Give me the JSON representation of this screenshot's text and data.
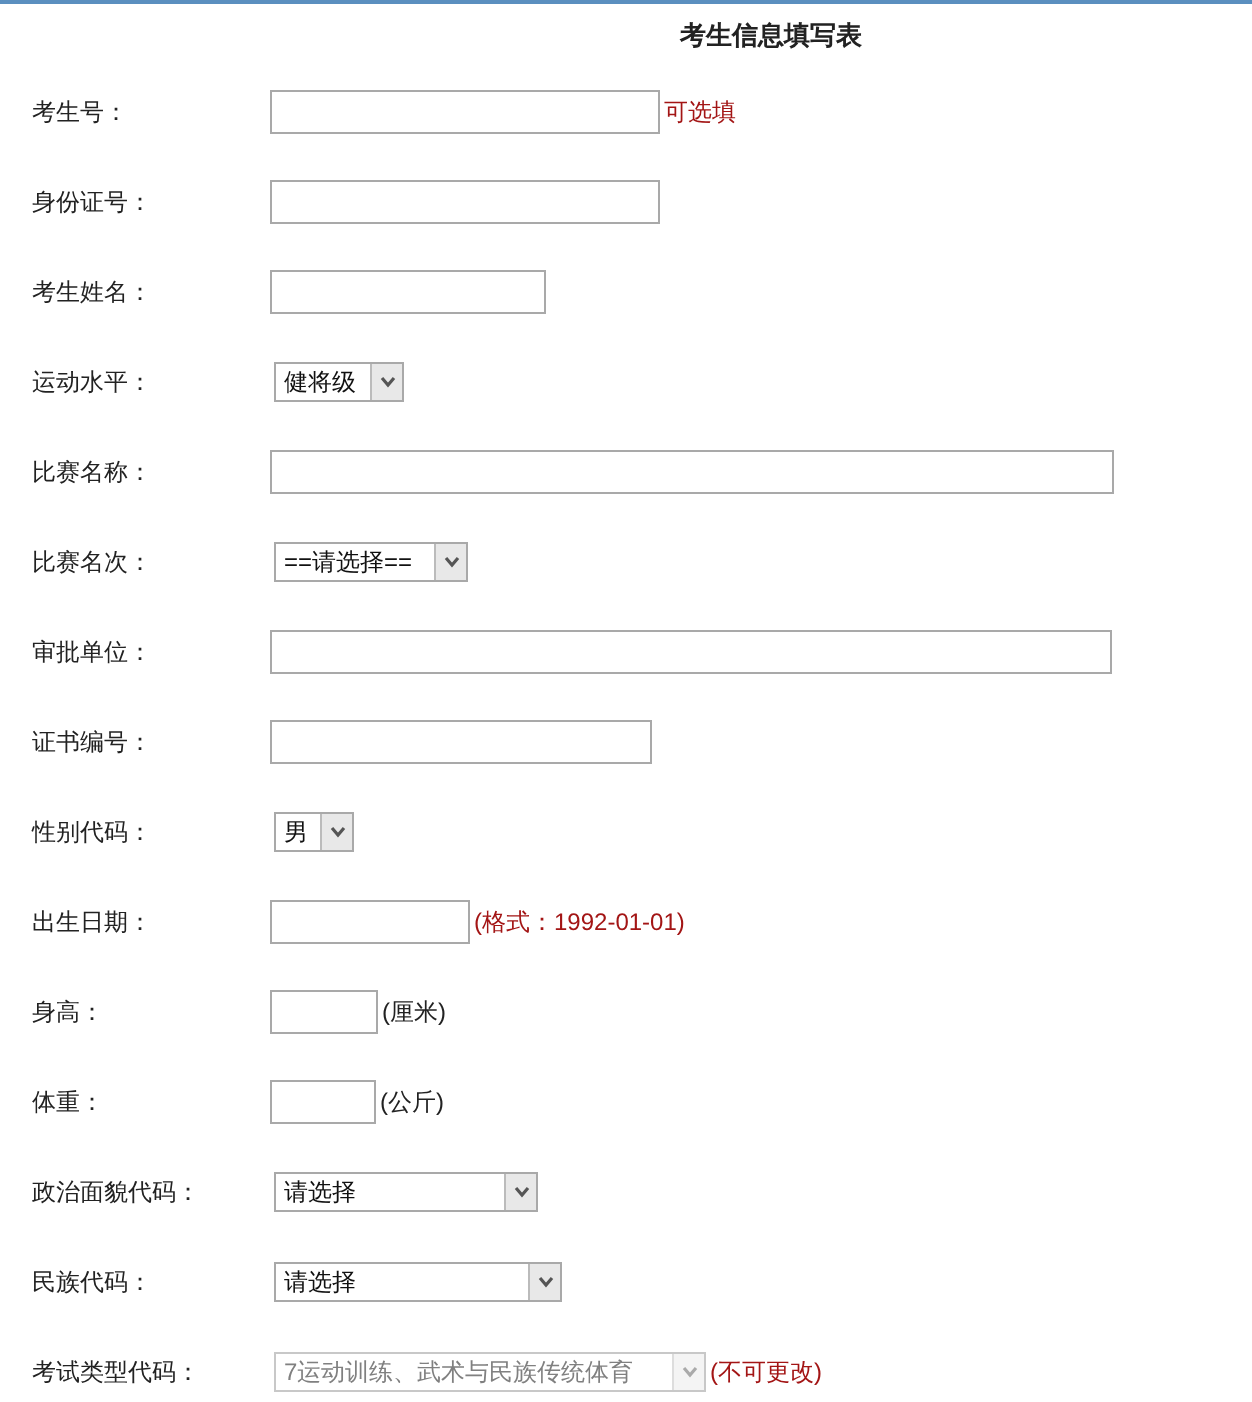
{
  "title": "考生信息填写表",
  "fields": [
    {
      "label": "考生号：",
      "kind": "text",
      "note": {
        "text": "可选填",
        "color": "#a31515"
      }
    },
    {
      "label": "身份证号：",
      "kind": "text"
    },
    {
      "label": "考生姓名：",
      "kind": "text"
    },
    {
      "label": "运动水平：",
      "kind": "select",
      "value": "健将级",
      "disabled": false
    },
    {
      "label": "比赛名称：",
      "kind": "text"
    },
    {
      "label": "比赛名次：",
      "kind": "select",
      "value": "==请选择==",
      "disabled": false
    },
    {
      "label": "审批单位：",
      "kind": "text"
    },
    {
      "label": "证书编号：",
      "kind": "text"
    },
    {
      "label": "性别代码：",
      "kind": "select",
      "value": "男",
      "disabled": false
    },
    {
      "label": "出生日期：",
      "kind": "text",
      "note": {
        "text": "(格式：1992-01-01)",
        "color": "#a31515"
      }
    },
    {
      "label": "身高：",
      "kind": "text",
      "note": {
        "text": "(厘米)",
        "color": "#222222"
      }
    },
    {
      "label": "体重：",
      "kind": "text",
      "note": {
        "text": "(公斤)",
        "color": "#222222"
      }
    },
    {
      "label": "政治面貌代码：",
      "kind": "select",
      "value": "请选择",
      "disabled": false
    },
    {
      "label": "民族代码：",
      "kind": "select",
      "value": "请选择",
      "disabled": false
    },
    {
      "label": "考试类型代码：",
      "kind": "select",
      "value": "7运动训练、武术与民族传统体育",
      "disabled": true,
      "note": {
        "text": "(不可更改)",
        "color": "#a31515"
      }
    }
  ]
}
